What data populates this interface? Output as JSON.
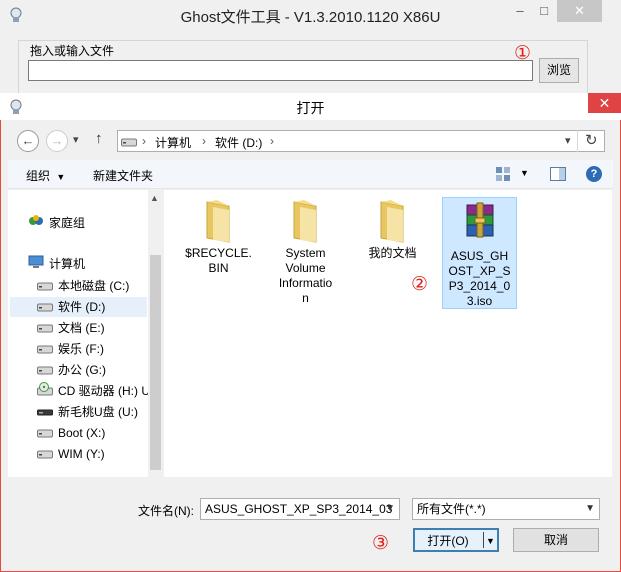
{
  "app": {
    "title": "Ghost文件工具 - V1.3.2010.1120 X86U",
    "group_label": "拖入或输入文件",
    "file_input_value": "",
    "browse_label": "浏览",
    "marker1": "①",
    "controls": {
      "minimize": "–",
      "maximize": "□",
      "close": "✕"
    }
  },
  "dialog": {
    "title": "打开",
    "close": "✕",
    "nav": {
      "back": "←",
      "forward": "→",
      "dropdown": "▾",
      "up": "↑",
      "refresh": "↻"
    },
    "address": {
      "crumbs": [
        "计算机",
        "软件 (D:)"
      ],
      "sep": "›"
    },
    "commands": {
      "organize": "组织",
      "new_folder": "新建文件夹",
      "help": "?"
    },
    "nav_pane": {
      "items": [
        {
          "label": "家庭组",
          "icon": "homegroup-icon"
        },
        {
          "label": "计算机",
          "icon": "computer-icon"
        },
        {
          "label": "本地磁盘 (C:)",
          "icon": "drive-icon"
        },
        {
          "label": "软件 (D:)",
          "icon": "drive-icon",
          "selected": true
        },
        {
          "label": "文档 (E:)",
          "icon": "drive-icon"
        },
        {
          "label": "娱乐 (F:)",
          "icon": "drive-icon"
        },
        {
          "label": "办公 (G:)",
          "icon": "drive-icon"
        },
        {
          "label": "CD 驱动器 (H:) U",
          "icon": "cd-drive-icon"
        },
        {
          "label": "新毛桃U盘 (U:)",
          "icon": "usb-drive-icon"
        },
        {
          "label": "Boot (X:)",
          "icon": "drive-icon"
        },
        {
          "label": "WIM (Y:)",
          "icon": "drive-icon"
        }
      ]
    },
    "files": [
      {
        "lines": [
          "$RECYCLE.",
          "BIN"
        ],
        "icon": "folder-icon"
      },
      {
        "lines": [
          "System",
          "Volume",
          "Informatio",
          "n"
        ],
        "icon": "folder-icon"
      },
      {
        "lines": [
          "我的文档"
        ],
        "icon": "folder-icon"
      },
      {
        "lines": [
          "ASUS_GH",
          "OST_XP_S",
          "P3_2014_0",
          "3.iso"
        ],
        "icon": "archive-icon",
        "selected": true
      }
    ],
    "marker2": "②",
    "filename_label": "文件名(N):",
    "filename_value": "ASUS_GHOST_XP_SP3_2014_03",
    "filetype_value": "所有文件(*.*)",
    "open_label": "打开(O)",
    "cancel_label": "取消",
    "marker3": "③"
  },
  "colors": {
    "accent": "#e04343",
    "selection": "#cde8ff",
    "marker": "#e0201c",
    "folder": "#e8c660"
  }
}
